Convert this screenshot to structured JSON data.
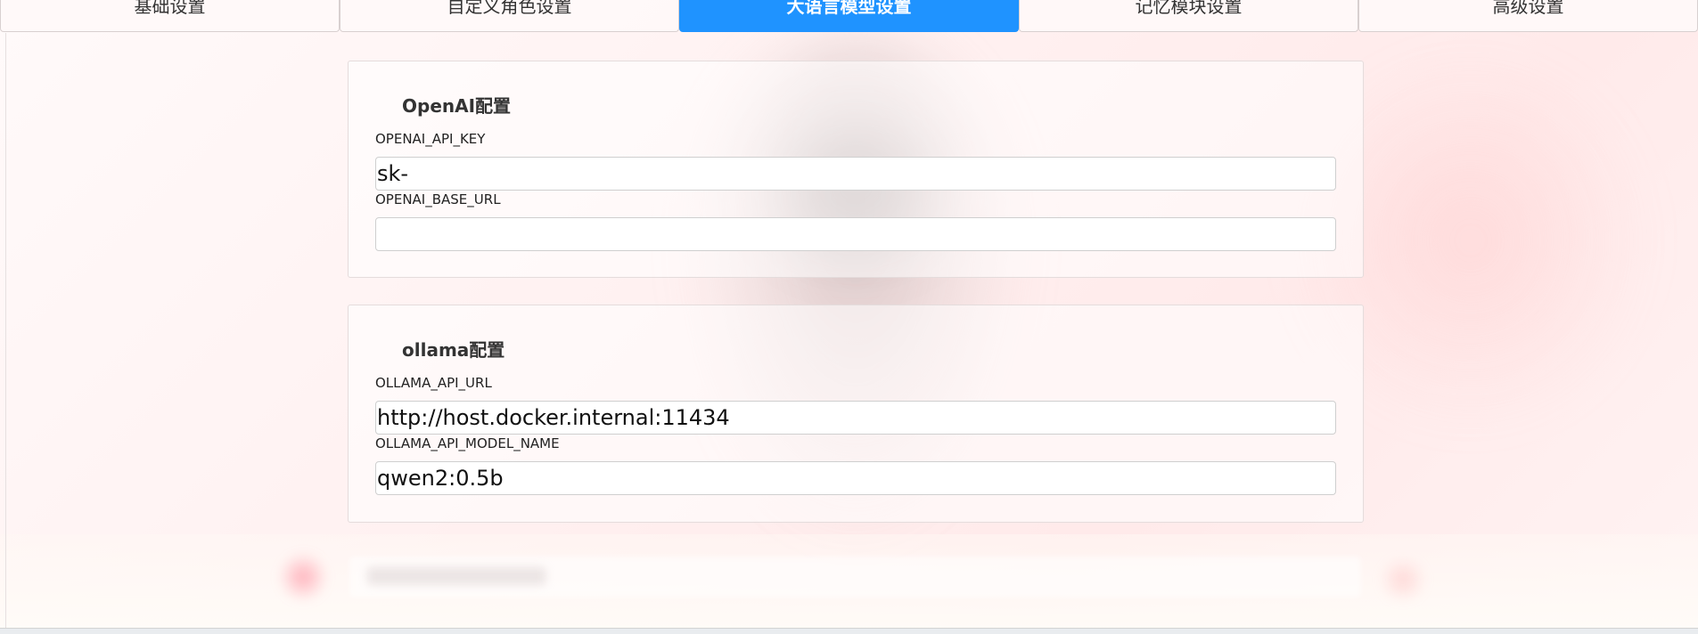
{
  "tabs": [
    {
      "label": "基础设置",
      "active": false
    },
    {
      "label": "自定义角色设置",
      "active": false
    },
    {
      "label": "大语言模型设置",
      "active": true
    },
    {
      "label": "记忆模块设置",
      "active": false
    },
    {
      "label": "高级设置",
      "active": false
    }
  ],
  "openai": {
    "title": "OpenAI配置",
    "api_key": {
      "label": "OPENAI_API_KEY",
      "value": "sk-"
    },
    "base_url": {
      "label": "OPENAI_BASE_URL",
      "value": ""
    }
  },
  "ollama": {
    "title": "ollama配置",
    "api_url": {
      "label": "OLLAMA_API_URL",
      "value": "http://host.docker.internal:11434"
    },
    "model_name": {
      "label": "OLLAMA_API_MODEL_NAME",
      "value": "qwen2:0.5b"
    }
  },
  "colors": {
    "active_tab": "#1f93ff",
    "card_border": "#e4dcdc",
    "background": "#fff1f1"
  }
}
